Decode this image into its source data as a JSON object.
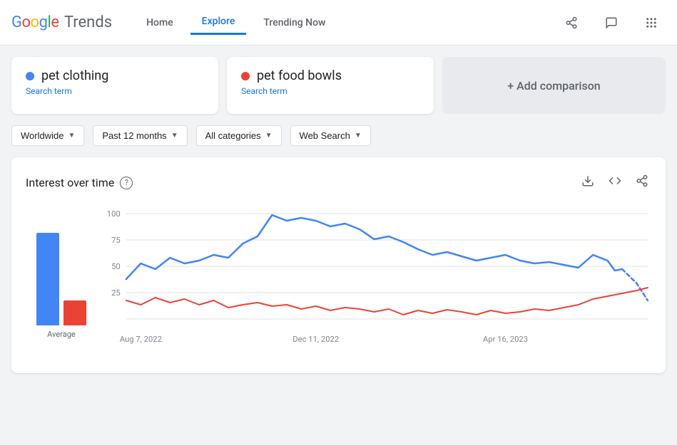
{
  "logo": {
    "google": "Google",
    "trends": "Trends"
  },
  "nav": {
    "items": [
      {
        "label": "Home",
        "active": false
      },
      {
        "label": "Explore",
        "active": true
      },
      {
        "label": "Trending Now",
        "active": false
      }
    ]
  },
  "header_icons": [
    {
      "name": "share-icon",
      "symbol": "⬆"
    },
    {
      "name": "feedback-icon",
      "symbol": "💬"
    },
    {
      "name": "apps-icon",
      "symbol": "⠿"
    }
  ],
  "search_cards": [
    {
      "id": "card1",
      "dot_color": "blue",
      "term": "pet clothing",
      "label": "Search term"
    },
    {
      "id": "card2",
      "dot_color": "red",
      "term": "pet food bowls",
      "label": "Search term"
    }
  ],
  "add_comparison": {
    "label": "+ Add comparison"
  },
  "filters": [
    {
      "id": "geo",
      "label": "Worldwide"
    },
    {
      "id": "time",
      "label": "Past 12 months"
    },
    {
      "id": "category",
      "label": "All categories"
    },
    {
      "id": "search_type",
      "label": "Web Search"
    }
  ],
  "chart": {
    "title": "Interest over time",
    "avg_label": "Average",
    "avg_blue_height": 130,
    "avg_red_height": 35,
    "y_labels": [
      "100",
      "75",
      "50",
      "25"
    ],
    "x_labels": [
      "Aug 7, 2022",
      "Dec 11, 2022",
      "Apr 16, 2023"
    ],
    "actions": [
      {
        "name": "download-icon",
        "symbol": "⬇"
      },
      {
        "name": "embed-icon",
        "symbol": "</>"
      },
      {
        "name": "share-icon",
        "symbol": "⬆"
      }
    ]
  }
}
